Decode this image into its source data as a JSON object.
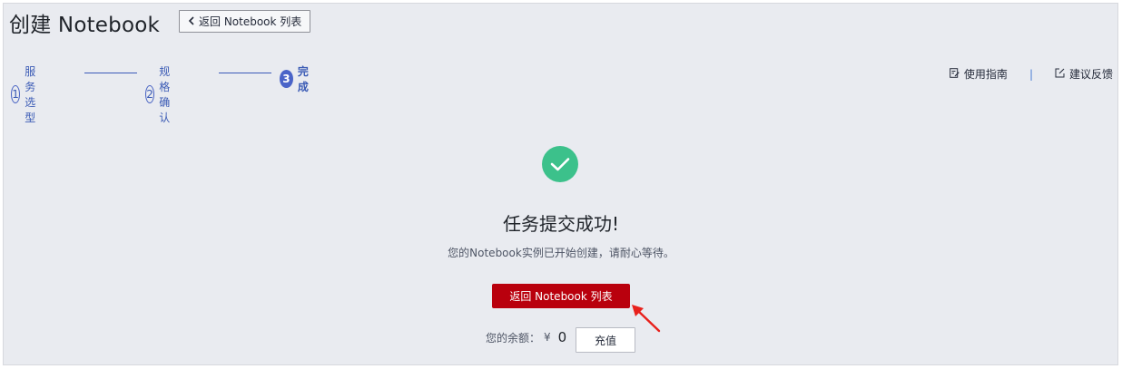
{
  "header": {
    "title": "创建 Notebook",
    "back_button_label": "返回 Notebook 列表"
  },
  "steps": [
    {
      "number": "1",
      "label": "服务选型",
      "state": "done"
    },
    {
      "number": "2",
      "label": "规格确认",
      "state": "done"
    },
    {
      "number": "3",
      "label": "完成",
      "state": "active"
    }
  ],
  "top_links": {
    "guide_label": "使用指南",
    "divider": "|",
    "feedback_label": "建议反馈"
  },
  "result": {
    "icon": "check-circle-icon",
    "title": "任务提交成功!",
    "message": "您的Notebook实例已开始创建，请耐心等待。",
    "primary_button_label": "返回 Notebook 列表"
  },
  "balance": {
    "label": "您的余额：",
    "currency": "¥",
    "amount": "0",
    "recharge_label": "充值"
  },
  "colors": {
    "background": "#e9ebf0",
    "step_accent": "#4a64c8",
    "success": "#3cc18b",
    "primary_button": "#b9000d",
    "annotation_arrow": "#e8211c"
  }
}
